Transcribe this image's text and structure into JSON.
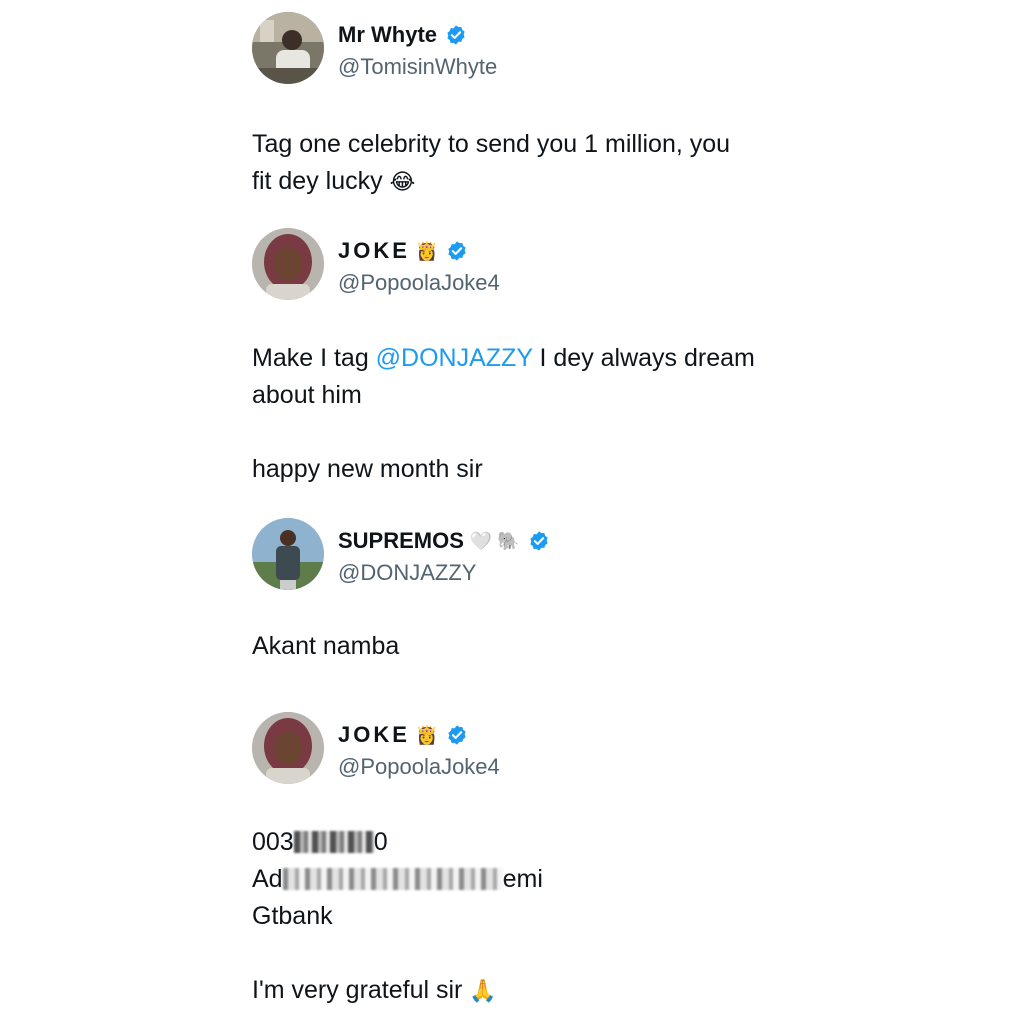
{
  "tweets": [
    {
      "name": "Mr Whyte",
      "handle": "@TomisinWhyte",
      "verified": true,
      "lines": [
        "Tag one celebrity to send you 1 million, you",
        "fit dey lucky"
      ],
      "trailing_emoji": "😂"
    },
    {
      "name": "JOKE",
      "name_emoji": "👸",
      "handle": "@PopoolaJoke4",
      "verified": true,
      "line1_before": "Make I tag ",
      "mention": "@DONJAZZY",
      "line1_after": " I dey always dream",
      "line2": "about him",
      "line3": "happy new month sir"
    },
    {
      "name": "SUPREMOS",
      "name_emoji": "🤍 🐘",
      "handle": "@DONJAZZY",
      "verified": true,
      "text": "Akant namba"
    },
    {
      "name": "JOKE",
      "name_emoji": "👸",
      "handle": "@PopoolaJoke4",
      "verified": true,
      "account_start": "003",
      "account_end": "0",
      "name_start": "Ad",
      "name_end": "emi",
      "bank": "Gtbank",
      "closing": "I'm very grateful sir",
      "closing_emoji": "🙏"
    }
  ],
  "colors": {
    "verified_blue": "#1d9bf0",
    "mention_blue": "#1d9bf0",
    "handle_gray": "#536471",
    "text": "#0f1419"
  }
}
